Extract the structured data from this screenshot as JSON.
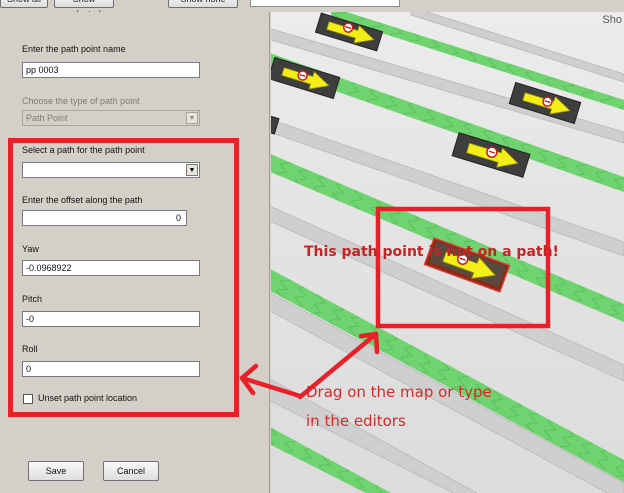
{
  "toolbar": {
    "buttons": [
      "Show all",
      "Show selected",
      "Show none"
    ]
  },
  "panel": {
    "name_label": "Enter the path point name",
    "name_value": "pp 0003",
    "type_label": "Choose the type of path point",
    "type_value": "Path Point",
    "path_label": "Select a path for the path point",
    "path_value": "",
    "offset_label": "Enter the offset along the path",
    "offset_value": "0",
    "yaw_label": "Yaw",
    "yaw_value": "-0.0968922",
    "pitch_label": "Pitch",
    "pitch_value": "-0",
    "roll_label": "Roll",
    "roll_value": "0",
    "unset_label": "Unset path point location",
    "unset_checked": false,
    "save_label": "Save",
    "cancel_label": "Cancel"
  },
  "map": {
    "corner_label": "Sho",
    "icons": {
      "path_point_marker": "arrow-marker-icon",
      "stop_sign": "no-entry-icon"
    }
  },
  "annotations": {
    "warning_text": "This path point is not on a path!",
    "hint_line1": "Drag on the map or type",
    "hint_line2": "in the editors"
  },
  "colors": {
    "annotation_red": "#e8202a",
    "road_green": "#6fd36f",
    "marker_yellow": "#f3ee1a",
    "selected_marker_red": "#e23b1e"
  }
}
